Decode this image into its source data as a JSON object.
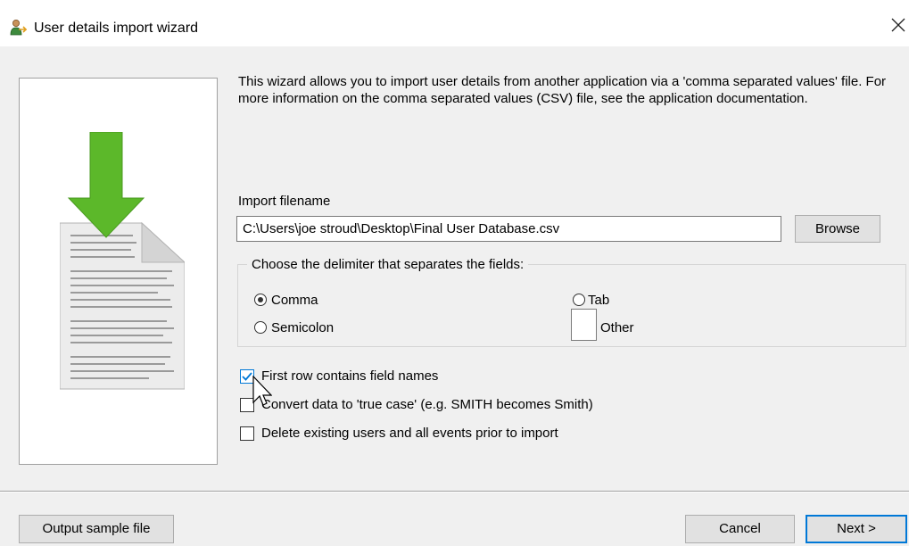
{
  "window": {
    "title": "User details import wizard",
    "title_icon": "user-icon",
    "close_icon": "close-icon"
  },
  "intro_text": "This wizard allows you to import user details from another application via a 'comma separated values' file. For more information on the comma separated values (CSV) file, see the application documentation.",
  "import": {
    "label": "Import filename",
    "value": "C:\\Users\\joe stroud\\Desktop\\Final User Database.csv",
    "browse_label": "Browse"
  },
  "delimiter": {
    "legend": "Choose the delimiter that separates the fields:",
    "options": [
      {
        "label": "Comma",
        "selected": true
      },
      {
        "label": "Tab",
        "selected": false
      },
      {
        "label": "Semicolon",
        "selected": false
      },
      {
        "label": "Other",
        "selected": false
      }
    ],
    "other_value": ""
  },
  "options": [
    {
      "label": "First row contains field names",
      "checked": true
    },
    {
      "label": "Convert data to 'true case' (e.g. SMITH becomes Smith)",
      "checked": false
    },
    {
      "label": "Delete existing users and all events prior to import",
      "checked": false
    }
  ],
  "footer": {
    "output_sample_label": "Output sample file",
    "cancel_label": "Cancel",
    "next_label": "Next >"
  },
  "colors": {
    "accent": "#0078d7",
    "arrow_green": "#5cb82a",
    "dialog_bg": "#f0f0f0"
  },
  "icons": {
    "wizard_illustration": "download-document-icon",
    "cursor": "mouse-pointer-icon"
  }
}
